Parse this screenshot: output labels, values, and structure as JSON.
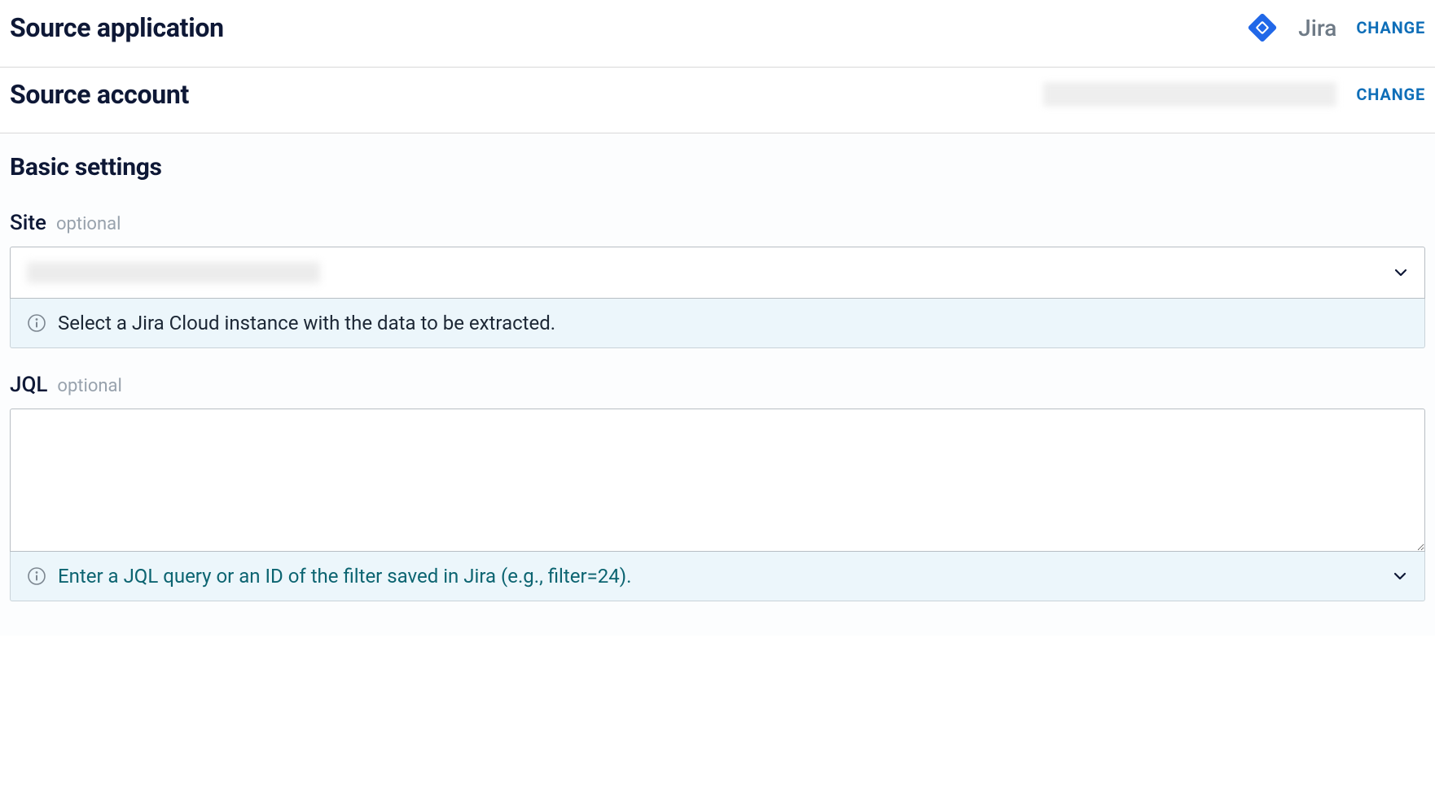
{
  "sourceApplication": {
    "title": "Source application",
    "appName": "Jira",
    "changeLabel": "CHANGE"
  },
  "sourceAccount": {
    "title": "Source account",
    "changeLabel": "CHANGE"
  },
  "basicSettings": {
    "title": "Basic settings",
    "site": {
      "label": "Site",
      "optional": "optional",
      "helpText": "Select a Jira Cloud instance with the data to be extracted."
    },
    "jql": {
      "label": "JQL",
      "optional": "optional",
      "value": "",
      "helpText": "Enter a JQL query or an ID of the filter saved in Jira (e.g., filter=24)."
    }
  }
}
